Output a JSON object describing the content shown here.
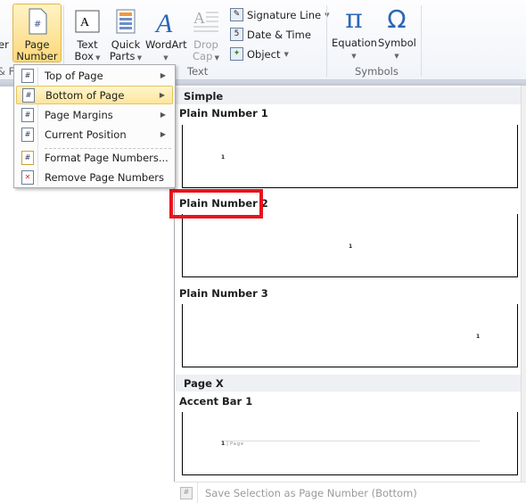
{
  "ribbon": {
    "partial_left": "er",
    "page_number": "Page\nNumber",
    "page_number_l1": "Page",
    "page_number_l2": "Number",
    "text_box_l1": "Text",
    "text_box_l2": "Box",
    "quick_parts_l1": "Quick",
    "quick_parts_l2": "Parts",
    "wordart": "WordArt",
    "drop_cap_l1": "Drop",
    "drop_cap_l2": "Cap",
    "signature_line": "Signature Line",
    "date_time": "Date & Time",
    "object": "Object",
    "equation": "Equation",
    "symbol": "Symbol",
    "groups": {
      "partial": "& F",
      "text": "Text",
      "symbols": "Symbols"
    }
  },
  "menu": {
    "items": [
      {
        "label": "Top of Page",
        "submenu": true
      },
      {
        "label": "Bottom of Page",
        "submenu": true,
        "highlighted": true
      },
      {
        "label": "Page Margins",
        "submenu": true
      },
      {
        "label": "Current Position",
        "submenu": true
      },
      {
        "label": "Format Page Numbers...",
        "submenu": false
      },
      {
        "label": "Remove Page Numbers",
        "submenu": false
      }
    ]
  },
  "gallery": {
    "sections": [
      {
        "header": "Simple",
        "items": [
          "Plain Number 1",
          "Plain Number 2",
          "Plain Number 3"
        ]
      },
      {
        "header": "Page X",
        "items": [
          "Accent Bar 1"
        ]
      }
    ],
    "preview_number": "1",
    "accent_text": "Page",
    "highlighted_item": "Plain Number 2",
    "footer": "Save Selection as Page Number (Bottom)"
  },
  "colors": {
    "highlight": "#e8141c",
    "hover": "#fde69a",
    "accent": "#2b66b7"
  }
}
